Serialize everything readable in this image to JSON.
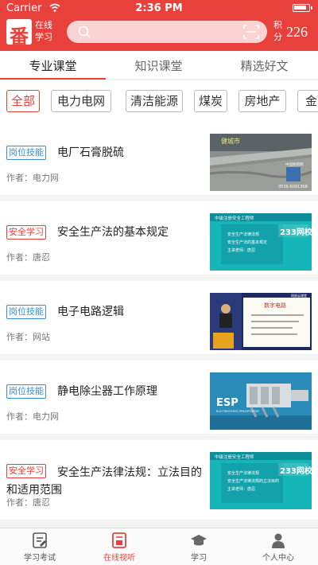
{
  "status_bar": {
    "carrier": "Carrier",
    "time": "2:36 PM"
  },
  "header": {
    "logo_char": "番",
    "logo_text": "在线学习",
    "points_label": "积分",
    "points_value": "226"
  },
  "tabs": [
    {
      "label": "专业课堂",
      "active": true
    },
    {
      "label": "知识课堂",
      "active": false
    },
    {
      "label": "精选好文",
      "active": false
    }
  ],
  "categories": [
    {
      "label": "全部",
      "active": true
    },
    {
      "label": "电力电网",
      "active": false
    },
    {
      "label": "清洁能源",
      "active": false
    },
    {
      "label": "煤炭",
      "active": false
    },
    {
      "label": "房地产",
      "active": false
    },
    {
      "label": "金融",
      "active": false
    }
  ],
  "courses": [
    {
      "tag": "岗位技能",
      "tag_color": "#3a8fd8",
      "title": "电厂石膏脱硫",
      "author": "作者：电力网",
      "thumb": {
        "kind": "photo",
        "overlay_text": "健城市",
        "contact": "0536-6091368",
        "brand": "中国脱硫网"
      }
    },
    {
      "tag": "安全学习",
      "tag_color": "#e8413b",
      "title": "安全生产法的基本规定",
      "author": "作者：唐忍",
      "thumb": {
        "kind": "slide",
        "header": "中级注册安全工程师",
        "brand": "233网校",
        "lines": [
          "安全生产法律法规",
          "安全生产法的基本规定",
          "主讲老师：唐忍"
        ]
      }
    },
    {
      "tag": "岗位技能",
      "tag_color": "#3a8fd8",
      "title": "电子电路逻辑",
      "author": "作者：网站",
      "thumb": {
        "kind": "lecture",
        "heading": "数字电路",
        "brand": "网易云课堂"
      }
    },
    {
      "tag": "岗位技能",
      "tag_color": "#3a8fd8",
      "title": "静电除尘器工作原理",
      "author": "作者：电力网",
      "thumb": {
        "kind": "esp",
        "big": "ESP",
        "sub": "ELECTROSTATIC PRECIPITATOR"
      }
    },
    {
      "tag": "安全学习",
      "tag_color": "#e8413b",
      "title": "安全生产法律法规：立法目的和适用范围",
      "author": "作者：唐忍",
      "thumb": {
        "kind": "slide",
        "header": "中级注册安全工程师",
        "brand": "233网校",
        "lines": [
          "安全生产法律法规",
          "安全生产法律法规的立法目的",
          "主讲老师：唐忍"
        ]
      }
    }
  ],
  "tabbar": [
    {
      "label": "学习考试",
      "icon": "exam-icon",
      "active": false
    },
    {
      "label": "在线视听",
      "icon": "video-icon",
      "active": true
    },
    {
      "label": "学习",
      "icon": "graduation-cap-icon",
      "active": false
    },
    {
      "label": "个人中心",
      "icon": "person-icon",
      "active": false
    }
  ],
  "colors": {
    "brand": "#e8413b",
    "tag_blue": "#3a8fd8"
  }
}
